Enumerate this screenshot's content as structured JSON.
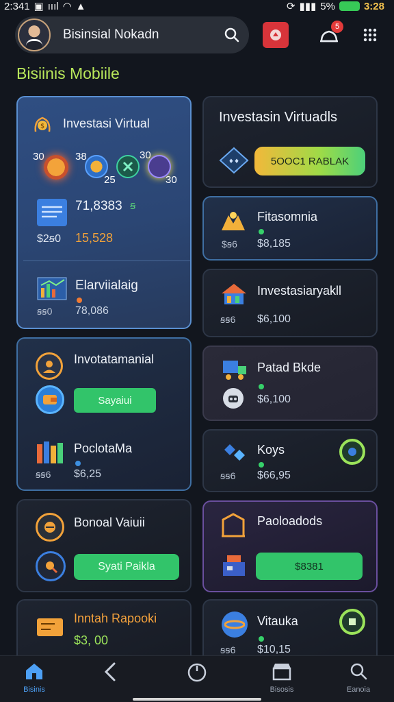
{
  "status_bar": {
    "time_left": "2:341",
    "signal": "ıııl",
    "battery_text": "5%",
    "time_right": "3:28"
  },
  "header": {
    "search_title": "Bisinsial Nokadn",
    "notification_count": "5"
  },
  "section_title": "Bisiinis Mobiile",
  "cards": {
    "featured": {
      "title": "Investasi Virtual",
      "coin_nums": [
        "30",
        "38",
        "25",
        "30",
        "30"
      ],
      "stat_value": "71,8383",
      "stat_suffix": "ꞩ",
      "label1": "$2ꞩ0",
      "value1": "15,528",
      "sub_title": "Elarviialaig",
      "sub_label": "ꞩꞩ0",
      "sub_value": "78,086"
    },
    "investasi_top": {
      "title": "Investasin Virtuadls",
      "pill": "5OOC1  RABLAK"
    },
    "fitasomnia": {
      "title": "Fitasomnia",
      "label": "$ꞩ6",
      "value": "$8,185"
    },
    "investasiary": {
      "title": "Investasiaryakll",
      "label": "ꞩꞩ6",
      "value": "$6,100"
    },
    "invotamanual": {
      "title": "Invotatamanial",
      "button": "Sayaiui"
    },
    "patad": {
      "title": "Patad Bkde",
      "value": "$6,100"
    },
    "poclota": {
      "title": "PoclotaMa",
      "label": "ꞩꞩ6",
      "value": "$6,25"
    },
    "koys": {
      "title": "Koys",
      "label": "ꞩꞩ6",
      "value": "$66,95"
    },
    "bonal": {
      "title": "Bonoal Vaiuii",
      "button": "Syati Paikla"
    },
    "paoloadods": {
      "title": "Paoloadods",
      "pill": "$8381"
    },
    "inntah": {
      "title": "Inntah Rapooki",
      "value": "$3, 00"
    },
    "vitauka": {
      "title": "Vitauka",
      "label": "ꞩꞩ6",
      "value": "$10,15"
    }
  },
  "nav": {
    "items": [
      {
        "label": "Bisinis",
        "icon": "home-icon"
      },
      {
        "label": "",
        "icon": "back-icon"
      },
      {
        "label": "",
        "icon": "power-icon"
      },
      {
        "label": "Bisosis",
        "icon": "store-icon"
      },
      {
        "label": "Eanoia",
        "icon": "search-icon"
      }
    ]
  },
  "colors": {
    "accent_green": "#32c46a",
    "section_title": "#b9e85b",
    "featured_bg": "#2f4e82"
  }
}
